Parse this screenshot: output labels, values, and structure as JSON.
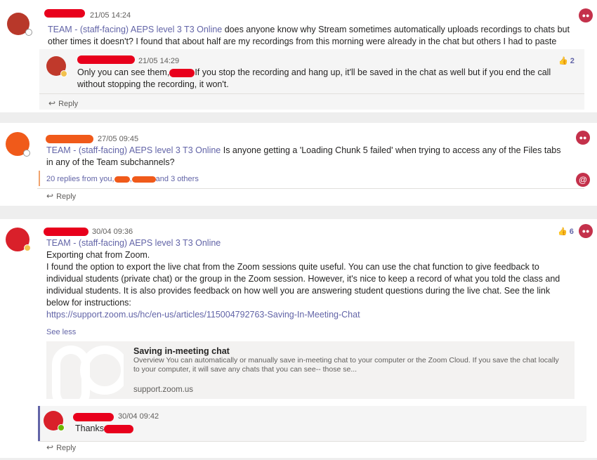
{
  "colors": {
    "accent": "#6264a7",
    "redact": "#e8001c",
    "redact_orange": "#f05a1a",
    "mention": "#c4314b"
  },
  "post1": {
    "time": "21/05 14:24",
    "team": "TEAM - (staff-facing) AEPS level 3 T3 Online",
    "text": " does anyone know why Stream sometimes automatically uploads recordings to chats but other times it doesn't?  I found that about half are my recordings from this morning were already in the chat but others I had to paste there myself",
    "reply_item": {
      "time": "21/05 14:29",
      "text_a": "Only you can see them,",
      "text_b": "If you stop the recording and hang up, it'll be saved in the chat as well but if you end the call without stopping the recording, it won't.",
      "reaction_count": "2"
    },
    "reply_label": "Reply"
  },
  "post2": {
    "time": "27/05 09:45",
    "team": "TEAM - (staff-facing) AEPS level 3 T3 Online",
    "text": " Is anyone getting a 'Loading Chunk 5 failed' when trying to access any of the Files tabs in any of the Team subchannels?",
    "replies_a": "20 replies from you,",
    "replies_b": ",",
    "replies_c": "and 3 others",
    "reply_label": "Reply"
  },
  "post3": {
    "time": "30/04 09:36",
    "team": "TEAM - (staff-facing) AEPS level 3 T3 Online",
    "line1": "Exporting chat from Zoom.",
    "body": "I found the option to export the live chat from the Zoom sessions quite useful. You can use the chat function to give feedback to individual students (private chat) or the group in the Zoom session. However, it's nice to keep a record of what you told the class and individual students. It is also provides feedback on how well you are answering student questions during the live chat. See the link below for instructions:",
    "url": "https://support.zoom.us/hc/en-us/articles/115004792763-Saving-In-Meeting-Chat",
    "see_less": "See less",
    "reaction_count": "6",
    "card": {
      "title": "Saving in-meeting chat",
      "desc": "Overview You can automatically or manually save in-meeting chat to your computer or the Zoom Cloud. If you save the chat locally to your computer, it will save any chats that you can see-- those se...",
      "domain": "support.zoom.us"
    },
    "reply_item": {
      "time": "30/04 09:42",
      "text": "Thanks"
    },
    "reply_label": "Reply"
  }
}
